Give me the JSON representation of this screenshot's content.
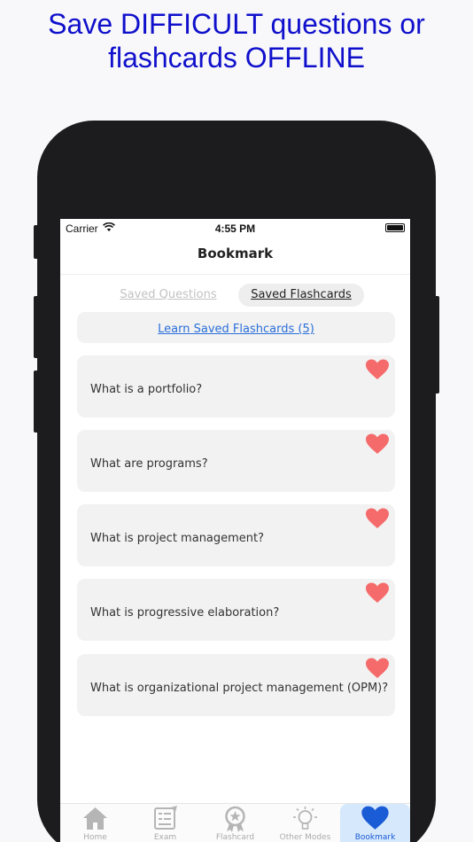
{
  "headline": {
    "line1": "Save DIFFICULT questions or",
    "line2": "flashcards OFFLINE"
  },
  "status_bar": {
    "carrier": "Carrier",
    "time": "4:55 PM"
  },
  "nav": {
    "title": "Bookmark"
  },
  "segments": {
    "questions": "Saved Questions",
    "flashcards": "Saved Flashcards",
    "active": "flashcards"
  },
  "learn_link": "Learn Saved Flashcards (5)",
  "cards": [
    {
      "question": "What is a portfolio?",
      "bookmarked": true
    },
    {
      "question": "What are programs?",
      "bookmarked": true
    },
    {
      "question": "What is project management?",
      "bookmarked": true
    },
    {
      "question": "What is progressive elaboration?",
      "bookmarked": true
    },
    {
      "question": "What is organizational project management (OPM)?",
      "bookmarked": true
    }
  ],
  "tabbar": [
    {
      "label": "Home",
      "icon": "home-icon"
    },
    {
      "label": "Exam",
      "icon": "exam-icon"
    },
    {
      "label": "Flashcard",
      "icon": "flashcard-badge-icon"
    },
    {
      "label": "Other Modes",
      "icon": "lightbulb-icon"
    },
    {
      "label": "Bookmark",
      "icon": "heart-icon",
      "active": true
    }
  ],
  "colors": {
    "headline": "#1010cc",
    "heart": "#f56b6b",
    "link": "#2a6fd8",
    "active_tab": "#1a5bd6",
    "active_tab_bg": "#d6e8fb"
  }
}
